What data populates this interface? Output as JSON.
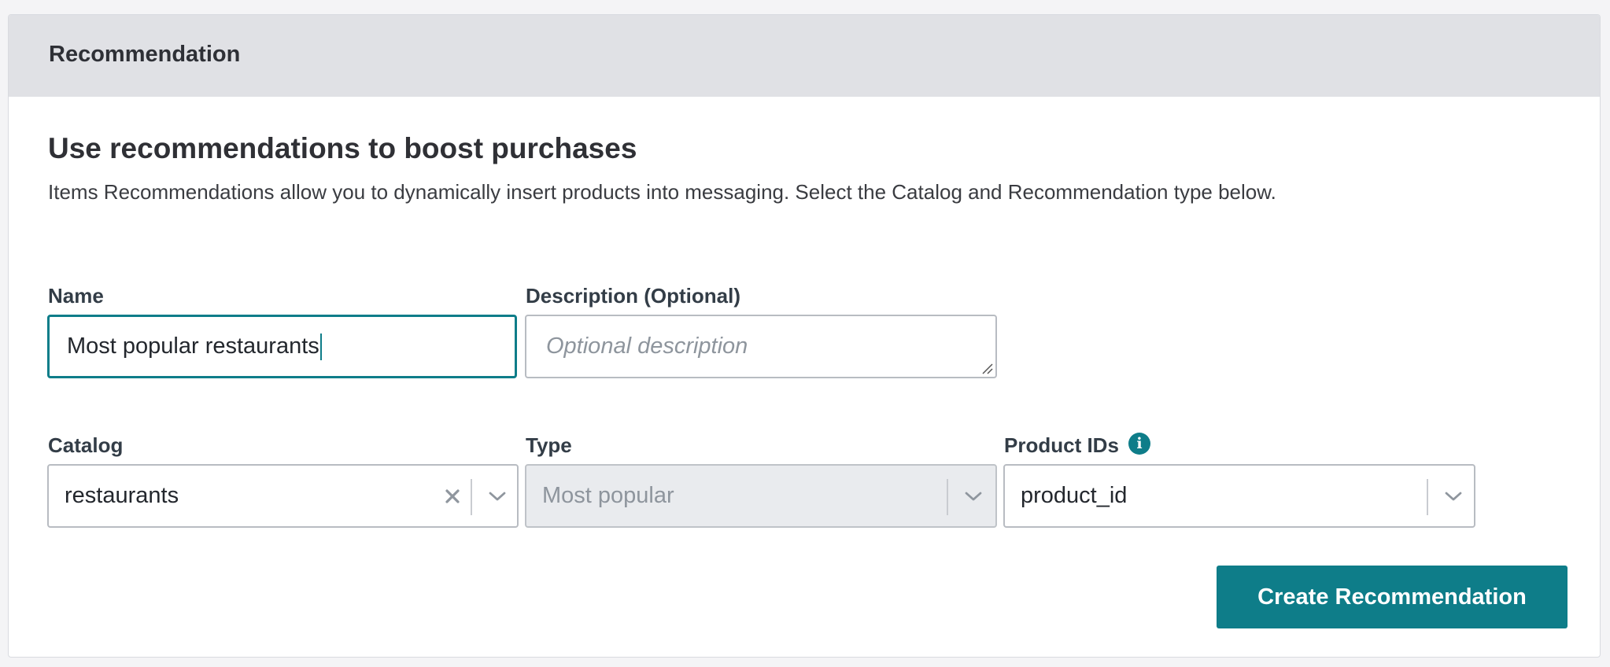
{
  "header": {
    "title": "Recommendation"
  },
  "intro": {
    "headline": "Use recommendations to boost purchases",
    "description": "Items Recommendations allow you to dynamically insert products into messaging. Select the Catalog and Recommendation type below."
  },
  "form": {
    "name": {
      "label": "Name",
      "value": "Most popular restaurants"
    },
    "description": {
      "label": "Description (Optional)",
      "placeholder": "Optional description"
    },
    "catalog": {
      "label": "Catalog",
      "value": "restaurants"
    },
    "type": {
      "label": "Type",
      "value": "Most popular",
      "disabled": true
    },
    "product_ids": {
      "label": "Product IDs",
      "value": "product_id",
      "info_icon": "info-icon"
    }
  },
  "actions": {
    "create_label": "Create Recommendation"
  },
  "colors": {
    "accent": "#0e7d89",
    "header_bg": "#e0e1e5",
    "disabled_bg": "#e9ebee"
  }
}
